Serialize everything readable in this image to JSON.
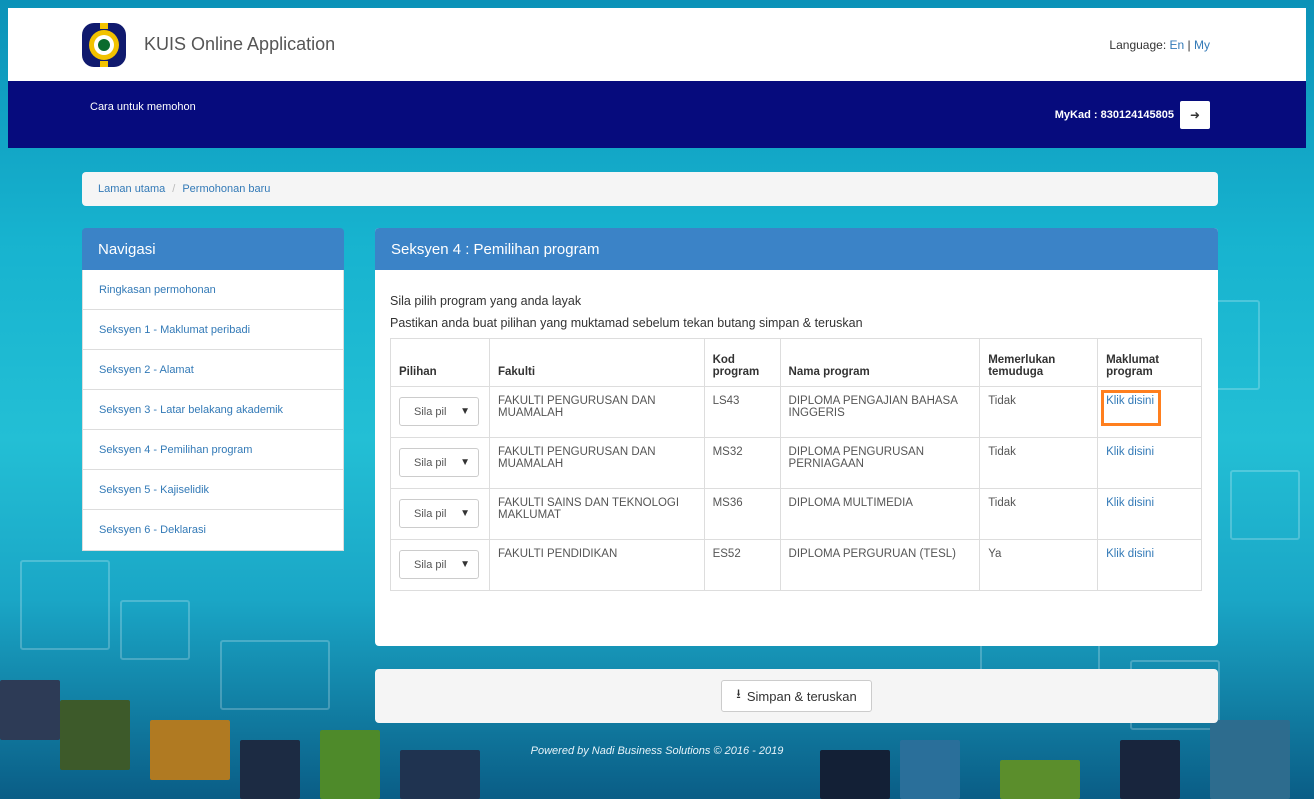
{
  "header": {
    "app_title": "KUIS Online Application",
    "language_label": "Language:",
    "lang_en": "En",
    "lang_sep": "|",
    "lang_my": "My"
  },
  "navbar": {
    "how_to_apply": "Cara untuk memohon",
    "mykad": "MyKad : 830124145805",
    "logout_icon": "logout-icon"
  },
  "breadcrumb": {
    "home": "Laman utama",
    "separator": "/",
    "current": "Permohonan baru"
  },
  "sidebar": {
    "title": "Navigasi",
    "items": [
      {
        "label": "Ringkasan permohonan"
      },
      {
        "label": "Seksyen 1 - Maklumat peribadi"
      },
      {
        "label": "Seksyen 2 - Alamat"
      },
      {
        "label": "Seksyen 3 - Latar belakang akademik"
      },
      {
        "label": "Seksyen 4 - Pemilihan program"
      },
      {
        "label": "Seksyen 5 - Kajiselidik"
      },
      {
        "label": "Seksyen 6 - Deklarasi"
      }
    ]
  },
  "main": {
    "title": "Seksyen 4 : Pemilihan program",
    "instruction_1": "Sila pilih program yang anda layak",
    "instruction_2": "Pastikan anda buat pilihan yang muktamad sebelum tekan butang simpan & teruskan",
    "columns": [
      "Pilihan",
      "Fakulti",
      "Kod program",
      "Nama program",
      "Memerlukan temuduga",
      "Maklumat program"
    ],
    "rows": [
      {
        "choice": "Sila pil",
        "faculty": "FAKULTI PENGURUSAN DAN MUAMALAH",
        "code": "LS43",
        "program": "DIPLOMA PENGAJIAN BAHASA INGGERIS",
        "interview": "Tidak",
        "info": "Klik disini"
      },
      {
        "choice": "Sila pil",
        "faculty": "FAKULTI PENGURUSAN DAN MUAMALAH",
        "code": "MS32",
        "program": "DIPLOMA PENGURUSAN PERNIAGAAN",
        "interview": "Tidak",
        "info": "Klik disini"
      },
      {
        "choice": "Sila pil",
        "faculty": "FAKULTI SAINS DAN TEKNOLOGI MAKLUMAT",
        "code": "MS36",
        "program": "DIPLOMA MULTIMEDIA",
        "interview": "Tidak",
        "info": "Klik disini"
      },
      {
        "choice": "Sila pil",
        "faculty": "FAKULTI PENDIDIKAN",
        "code": "ES52",
        "program": "DIPLOMA PERGURUAN (TESL)",
        "interview": "Ya",
        "info": "Klik disini"
      }
    ]
  },
  "actions": {
    "save_label": "Simpan & teruskan"
  },
  "footer": {
    "text": "Powered by Nadi Business Solutions © 2016 - 2019"
  },
  "colors": {
    "navbar": "#060b7d",
    "panel_header": "#3b83c7",
    "link": "#337ab7",
    "highlight": "#ff7f1e"
  }
}
